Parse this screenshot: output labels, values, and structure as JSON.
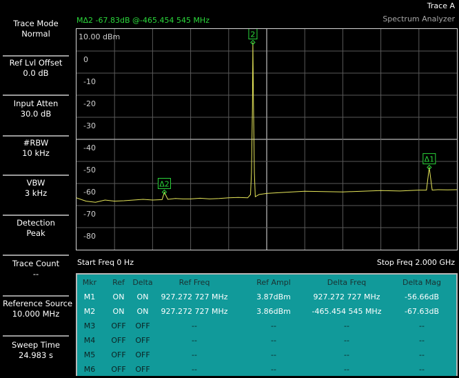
{
  "header": {
    "trace_title": "Trace A",
    "app_title": "Spectrum Analyzer",
    "marker_readout": "MΔ2  -67.83dB @-465.454 545 MHz"
  },
  "softkeys": [
    {
      "line1": "Trace Mode",
      "line2": "Normal"
    },
    {
      "line1": "Ref Lvl Offset",
      "line2": "0.0 dB"
    },
    {
      "line1": "Input Atten",
      "line2": "30.0 dB"
    },
    {
      "line1": "#RBW",
      "line2": "10 kHz"
    },
    {
      "line1": "VBW",
      "line2": "3 kHz"
    },
    {
      "line1": "Detection",
      "line2": "Peak"
    },
    {
      "line1": "Trace Count",
      "line2": "--"
    },
    {
      "line1": "Reference Source",
      "line2": "10.000 MHz"
    },
    {
      "line1": "Sweep Time",
      "line2": "24.983 s"
    }
  ],
  "plot": {
    "ref_level_label": "10.00 dBm",
    "y_labels": [
      "0",
      "-10",
      "-20",
      "-30",
      "-40",
      "-50",
      "-60",
      "-70",
      "-80"
    ],
    "start_freq": "Start Freq 0 Hz",
    "stop_freq": "Stop Freq 2.000 GHz",
    "markers": [
      {
        "label": "2",
        "freq_mhz": 927.3,
        "level_dbm": 3.9
      },
      {
        "label": "Δ2",
        "freq_mhz": 461.8,
        "level_dbm": -63.9
      },
      {
        "label": "Δ1",
        "freq_mhz": 1854.5,
        "level_dbm": -52.7
      }
    ]
  },
  "colors": {
    "trace": "#e8e85a",
    "marker": "#2bd83b",
    "grid": "#5a5a5a",
    "table_bg": "#119a9a"
  },
  "chart_data": {
    "type": "line",
    "title": "",
    "xlabel": "",
    "ylabel": "",
    "x_unit": "MHz",
    "y_unit": "dBm",
    "xlim": [
      0,
      2000
    ],
    "ylim": [
      -90,
      10
    ],
    "grid": true,
    "series": [
      {
        "x": [
          0,
          50,
          100,
          150,
          200,
          250,
          300,
          350,
          400,
          450,
          461.8,
          480,
          520,
          560,
          600,
          650,
          700,
          750,
          800,
          850,
          900,
          915,
          920,
          925,
          927.3,
          930,
          935,
          940,
          960,
          1000,
          1100,
          1200,
          1300,
          1400,
          1500,
          1600,
          1700,
          1800,
          1840,
          1854.5,
          1870,
          1900,
          1950,
          2000
        ],
        "y": [
          -66.5,
          -68,
          -68.5,
          -67.5,
          -68,
          -67.8,
          -67.5,
          -67.2,
          -67.5,
          -67.3,
          -64,
          -67.2,
          -66.8,
          -67,
          -67,
          -66.7,
          -67,
          -66.8,
          -66.5,
          -66.3,
          -66.5,
          -65,
          -55,
          -25,
          3.9,
          -22,
          -55,
          -66,
          -65,
          -64.5,
          -64,
          -63.5,
          -63.7,
          -63.8,
          -63.5,
          -63.2,
          -63.4,
          -63,
          -63,
          -52.7,
          -63,
          -62.8,
          -62.9,
          -62.8
        ]
      }
    ]
  },
  "marker_table": {
    "headers": [
      "Mkr",
      "Ref",
      "Delta",
      "Ref Freq",
      "Ref Ampl",
      "Delta Freq",
      "Delta Mag"
    ],
    "rows": [
      [
        "M1",
        "ON",
        "ON",
        "927.272 727 MHz",
        "3.87dBm",
        "927.272 727 MHz",
        "-56.66dB"
      ],
      [
        "M2",
        "ON",
        "ON",
        "927.272 727 MHz",
        "3.86dBm",
        "-465.454 545 MHz",
        "-67.63dB"
      ],
      [
        "M3",
        "OFF",
        "OFF",
        "--",
        "--",
        "--",
        "--"
      ],
      [
        "M4",
        "OFF",
        "OFF",
        "--",
        "--",
        "--",
        "--"
      ],
      [
        "M5",
        "OFF",
        "OFF",
        "--",
        "--",
        "--",
        "--"
      ],
      [
        "M6",
        "OFF",
        "OFF",
        "--",
        "--",
        "--",
        "--"
      ]
    ]
  }
}
